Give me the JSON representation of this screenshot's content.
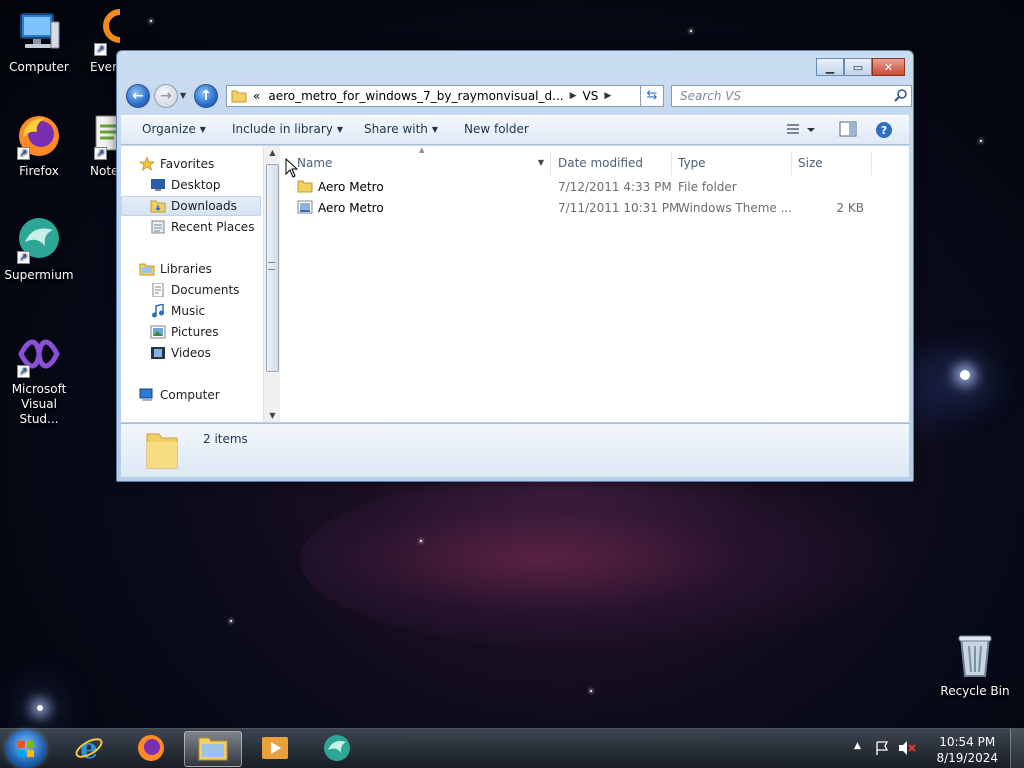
{
  "desktop": {
    "icons": [
      {
        "label": "Computer"
      },
      {
        "label": "Every"
      },
      {
        "label": "Firefox"
      },
      {
        "label": "Notep"
      },
      {
        "label": "Supermium"
      },
      {
        "label": "Microsoft Visual Stud..."
      },
      {
        "label": "Recycle Bin"
      }
    ]
  },
  "window": {
    "address": {
      "chevron": "«",
      "segments": [
        "aero_metro_for_windows_7_by_raymonvisual_d...",
        "VS"
      ]
    },
    "search_placeholder": "Search VS",
    "toolbar": {
      "organize": "Organize",
      "include_in_library": "Include in library",
      "share_with": "Share with",
      "new_folder": "New folder"
    },
    "nav": {
      "favorites": "Favorites",
      "favorites_items": [
        "Desktop",
        "Downloads",
        "Recent Places"
      ],
      "selected": "Downloads",
      "libraries": "Libraries",
      "libraries_items": [
        "Documents",
        "Music",
        "Pictures",
        "Videos"
      ],
      "computer": "Computer"
    },
    "columns": {
      "name": "Name",
      "date": "Date modified",
      "type": "Type",
      "size": "Size"
    },
    "files": [
      {
        "name": "Aero Metro",
        "date": "7/12/2011 4:33 PM",
        "type": "File folder",
        "size": "",
        "icon": "folder-icon"
      },
      {
        "name": "Aero Metro",
        "date": "7/11/2011 10:31 PM",
        "type": "Windows Theme ...",
        "size": "2 KB",
        "icon": "theme-file-icon"
      }
    ],
    "status": "2 items"
  },
  "taskbar": {
    "apps": [
      "internet-explorer",
      "firefox",
      "windows-explorer",
      "media-player",
      "supermium"
    ],
    "active_app": "windows-explorer",
    "time": "10:54 PM",
    "date": "8/19/2024"
  },
  "colors": {
    "accent": "#2d6fc9",
    "close_button": "#c94a33",
    "selection": "#d4e3f4"
  }
}
